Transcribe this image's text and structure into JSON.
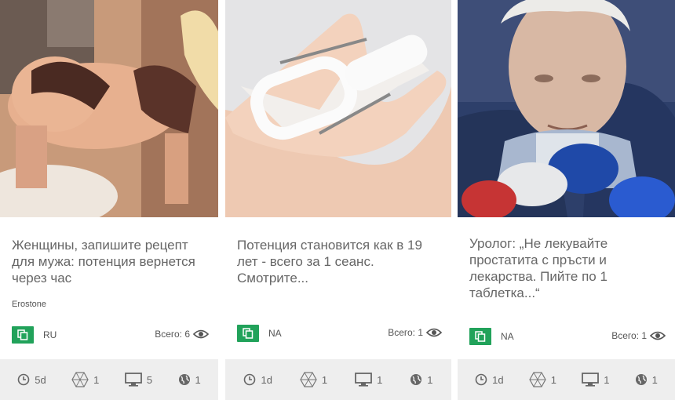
{
  "cards": [
    {
      "image_alt": "woman in lingerie",
      "headline": "Женщины, запишите рецепт для мужа: потенция вернется через час",
      "source": "Erostone",
      "lang": "RU",
      "views_label": "Всего: 6",
      "footer": {
        "age": "5d",
        "tags": "1",
        "screens": "5",
        "geo": "1"
      }
    },
    {
      "image_alt": "white device in hand",
      "headline": "Потенция становится как в 19 лет - всего за 1 сеанс. Смотрите...",
      "source": "",
      "lang": "NA",
      "views_label": "Всего: 1",
      "footer": {
        "age": "1d",
        "tags": "1",
        "screens": "1",
        "geo": "1"
      }
    },
    {
      "image_alt": "elderly man at press conference",
      "headline": "Уролог: „Не лекувайте простатита с пръсти и лекарства. Пийте по 1 таблетка...“",
      "source": "",
      "lang": "NA",
      "views_label": "Всего: 1",
      "footer": {
        "age": "1d",
        "tags": "1",
        "screens": "1",
        "geo": "1"
      }
    }
  ],
  "colors": {
    "accent_green": "#21a25a",
    "footer_bg": "#eeeeee",
    "text_grey": "#666666"
  },
  "icons": [
    "copy-icon",
    "eye-icon",
    "clock-icon",
    "hexagon-icon",
    "monitor-icon",
    "globe-icon"
  ]
}
